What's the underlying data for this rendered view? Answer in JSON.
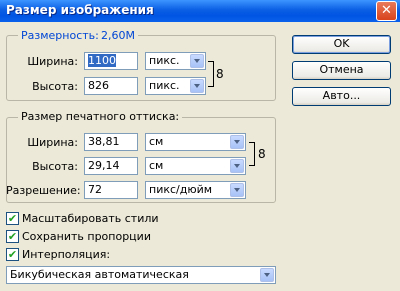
{
  "window": {
    "title": "Размер изображения",
    "close": "✕"
  },
  "dimensions": {
    "legend_label": "Размерность:",
    "legend_value": "2,60M",
    "width_label": "Ширина:",
    "width_value": "1100",
    "width_unit": "пикс.",
    "height_label": "Высота:",
    "height_value": "826",
    "height_unit": "пикс."
  },
  "print": {
    "legend": "Размер печатного оттиска:",
    "width_label": "Ширина:",
    "width_value": "38,81",
    "width_unit": "см",
    "height_label": "Высота:",
    "height_value": "29,14",
    "height_unit": "см",
    "resolution_label": "Разрешение:",
    "resolution_value": "72",
    "resolution_unit": "пикс/дюйм"
  },
  "buttons": {
    "ok": "OK",
    "cancel": "Отмена",
    "auto": "Авто..."
  },
  "options": {
    "scale_styles": "Масштабировать стили",
    "constrain": "Сохранить пропорции",
    "resample": "Интерполяция:",
    "check_glyph": "✔",
    "chain_glyph": "8"
  },
  "interpolation": {
    "value": "Бикубическая автоматическая"
  }
}
